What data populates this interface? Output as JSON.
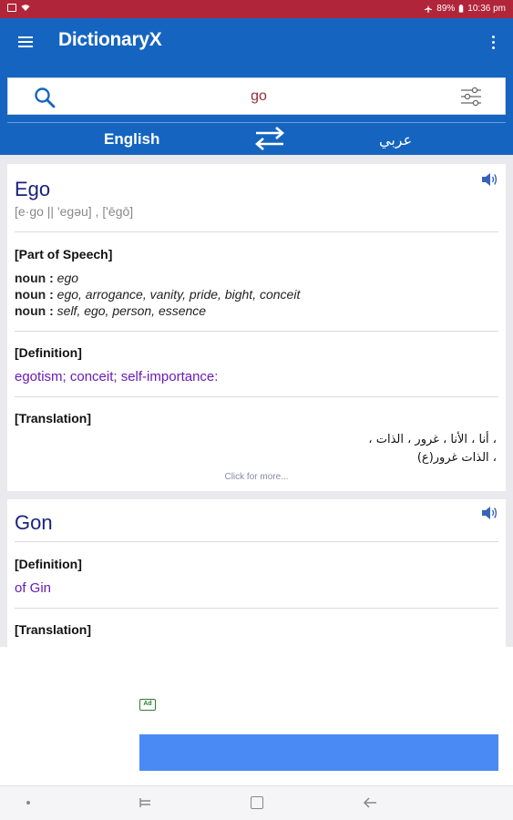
{
  "status_bar": {
    "battery": "89%",
    "time": "10:36 pm"
  },
  "app": {
    "title": "DictionaryX"
  },
  "search": {
    "value": "go",
    "placeholder": ""
  },
  "languages": {
    "source": "English",
    "target": "عربي"
  },
  "entries": [
    {
      "word": "Ego",
      "pronunciation": "[e·go || 'egəu]  ,  ['ēgō]",
      "pos_header": "[Part of Speech]",
      "pos": [
        {
          "label": "noun :",
          "values": "ego"
        },
        {
          "label": "noun :",
          "values": "ego, arrogance, vanity, pride, bight, conceit"
        },
        {
          "label": "noun :",
          "values": "self, ego, person, essence"
        }
      ],
      "definition_header": "[Definition]",
      "definition": "egotism; conceit; self-importance:",
      "translation_header": "[Translation]",
      "translations": [
        "، أنا ، الأنا ، غرور ، الذات ،",
        "، الذات غرور(ع)"
      ],
      "more": "Click for more..."
    },
    {
      "word": "Gon",
      "definition_header": "[Definition]",
      "definition": "of Gin",
      "translation_header": "[Translation]"
    }
  ],
  "ad": {
    "badge": "Ad",
    "banner_color": "#4a8af4"
  },
  "colors": {
    "primary": "#1565c0",
    "status_bar": "#b0253a",
    "word": "#1a237e",
    "definition": "#6a1ab5"
  }
}
